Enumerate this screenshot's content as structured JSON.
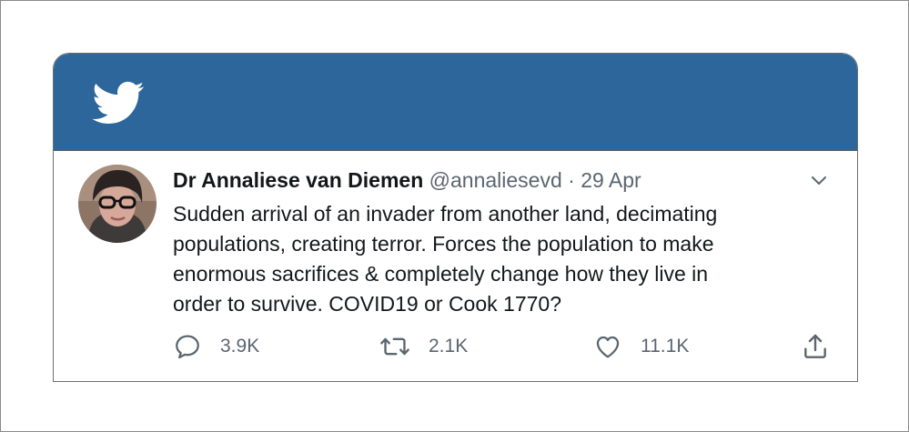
{
  "colors": {
    "banner": "#2d669b",
    "text_primary": "#14171a",
    "text_secondary": "#5b6670"
  },
  "icons": {
    "logo": "twitter-bird-icon",
    "menu": "chevron-down-icon",
    "reply": "reply-icon",
    "retweet": "retweet-icon",
    "like": "heart-icon",
    "share": "share-icon"
  },
  "tweet": {
    "author_name": "Dr Annaliese van Diemen",
    "handle": "@annaliesevd",
    "separator": "·",
    "date": "29 Apr",
    "text": "Sudden arrival of an invader from another land, decimating\npopulations, creating terror. Forces the population to make\nenormous sacrifices & completely change how they live in\norder to survive. COVID19 or Cook 1770?",
    "replies": "3.9K",
    "retweets": "2.1K",
    "likes": "11.1K"
  }
}
